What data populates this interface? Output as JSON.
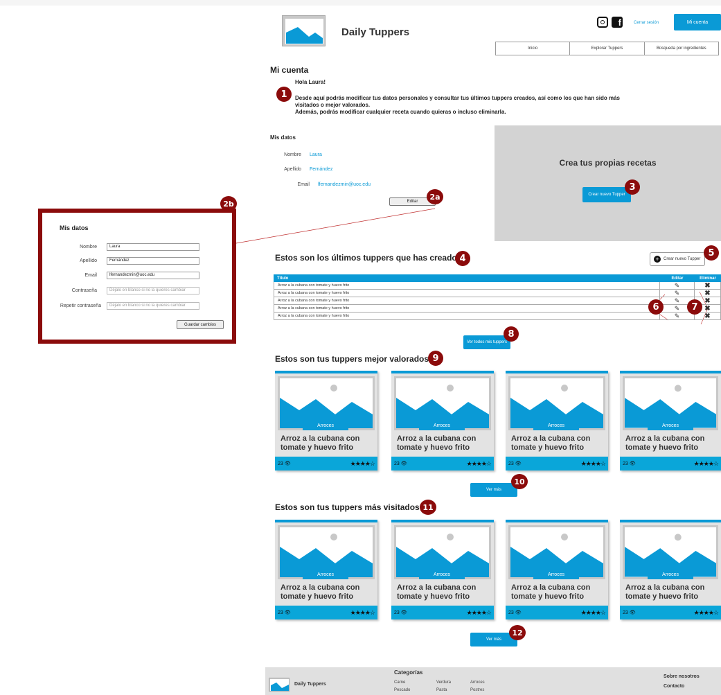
{
  "header": {
    "site_title": "Daily Tuppers",
    "instagram_icon": "instagram-icon",
    "facebook_icon": "facebook-icon",
    "logout_link": "Cerrar sesión",
    "account_button": "Mi cuenta"
  },
  "nav": {
    "items": [
      "Inicio",
      "Explorar Tuppers",
      "Búsqueda por ingredientes"
    ]
  },
  "page_title": "Mi cuenta",
  "intro": {
    "greeting": "Hola Laura!",
    "line1": "Desde aquí podrás modificar tus datos personales y consultar tus últimos tuppers creados, así como los que han sido más",
    "line2": "visitados o mejor valorados.",
    "line3": "Además, podrás modificar cualquier receta cuando quieras o incluso eliminarla."
  },
  "my_data": {
    "title": "Mis datos",
    "fields": [
      {
        "label": "Nombre",
        "value": "Laura"
      },
      {
        "label": "Apellido",
        "value": "Fernández"
      },
      {
        "label": "Email",
        "value": "lfernandezmin@uoc.edu"
      }
    ],
    "edit_button": "Editar"
  },
  "create_panel": {
    "title": "Crea tus propias recetas",
    "button": "Crear nuevo Tupper"
  },
  "latest": {
    "title": "Estos son los últimos tuppers que has creado",
    "create_button": "Crear nuevo Tupper",
    "columns": [
      "Título",
      "Editar",
      "Eliminar"
    ],
    "rows": [
      "Arroz a la cubana con tomate y huevo frito",
      "Arroz a la cubana con tomate y huevo frito",
      "Arroz a la cubana con tomate y huevo frito",
      "Arroz a la cubana con tomate y huevo frito",
      "Arroz a la cubana con tomate y huevo frito"
    ],
    "see_all_button": "Ver todos mis tuppers"
  },
  "best_rated": {
    "title": "Estos son tus tuppers mejor valorados",
    "see_more": "Ver más",
    "cards": [
      {
        "category": "Arroces",
        "title": "Arroz a la cubana con tomate y huevo frito",
        "views": "23",
        "rating": 4
      },
      {
        "category": "Arroces",
        "title": "Arroz a la cubana con tomate y huevo frito",
        "views": "23",
        "rating": 4
      },
      {
        "category": "Arroces",
        "title": "Arroz a la cubana con tomate y huevo frito",
        "views": "23",
        "rating": 4
      },
      {
        "category": "Arroces",
        "title": "Arroz a la cubana con tomate y huevo frito",
        "views": "23",
        "rating": 4
      }
    ]
  },
  "most_visited": {
    "title": "Estos son tus tuppers más visitados",
    "see_more": "Ver más",
    "cards": [
      {
        "category": "Arroces",
        "title": "Arroz a la cubana con tomate y huevo frito",
        "views": "23",
        "rating": 4
      },
      {
        "category": "Arroces",
        "title": "Arroz a la cubana con tomate y huevo frito",
        "views": "23",
        "rating": 4
      },
      {
        "category": "Arroces",
        "title": "Arroz a la cubana con tomate y huevo frito",
        "views": "23",
        "rating": 4
      },
      {
        "category": "Arroces",
        "title": "Arroz a la cubana con tomate y huevo frito",
        "views": "23",
        "rating": 4
      }
    ]
  },
  "edit_panel": {
    "title": "Mis datos",
    "fields": [
      {
        "label": "Nombre",
        "value": "Laura",
        "placeholder": ""
      },
      {
        "label": "Apellido",
        "value": "Fernández",
        "placeholder": ""
      },
      {
        "label": "Email",
        "value": "lfernandezmin@uoc.edu",
        "placeholder": ""
      },
      {
        "label": "Contraseña",
        "value": "",
        "placeholder": "Déjalo en blanco si no la quieres cambiar"
      },
      {
        "label": "Repetir contraseña",
        "value": "",
        "placeholder": "Déjalo en blanco si no la quieres cambiar"
      }
    ],
    "save_button": "Guardar cambios"
  },
  "badges": [
    "1",
    "2a",
    "2b",
    "3",
    "4",
    "5",
    "6",
    "7",
    "8",
    "9",
    "10",
    "11",
    "12"
  ],
  "footer": {
    "brand": "Daily Tuppers",
    "categories_title": "Categorías",
    "categories": [
      "Carne",
      "Verdura",
      "Arroces",
      "Pescado",
      "Pasta",
      "Postres"
    ],
    "about": "Sobre nosotros",
    "contact": "Contacto"
  },
  "colors": {
    "accent": "#0a9ad6",
    "annotation": "#8b0b0b",
    "panel": "#d3d3d3"
  }
}
